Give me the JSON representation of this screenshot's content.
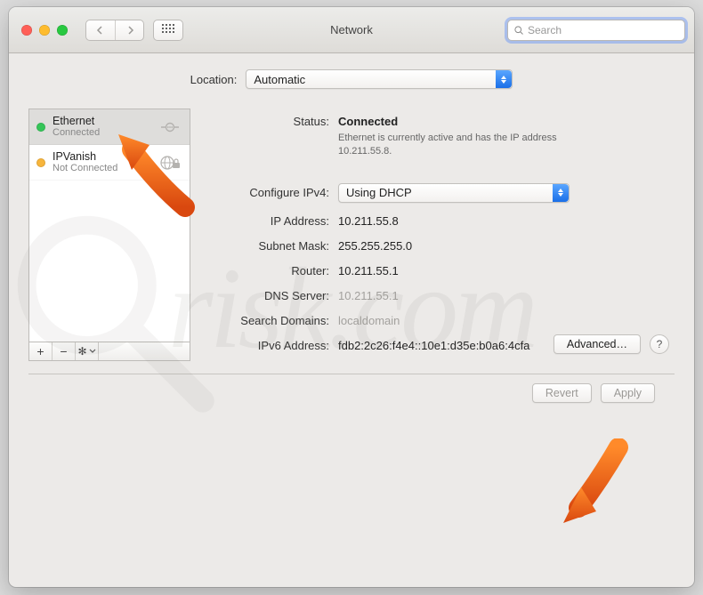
{
  "window": {
    "title": "Network"
  },
  "search": {
    "placeholder": "Search"
  },
  "location": {
    "label": "Location:",
    "value": "Automatic"
  },
  "sidebar": {
    "services": [
      {
        "name": "Ethernet",
        "status": "Connected",
        "dot": "green",
        "icon": "ethernet"
      },
      {
        "name": "IPVanish",
        "status": "Not Connected",
        "dot": "yellow",
        "icon": "vpn-globe"
      }
    ]
  },
  "detail": {
    "status_label": "Status:",
    "status_value": "Connected",
    "status_desc": "Ethernet is currently active and has the IP address 10.211.55.8.",
    "configure_label": "Configure IPv4:",
    "configure_value": "Using DHCP",
    "rows": [
      {
        "label": "IP Address:",
        "value": "10.211.55.8",
        "muted": false
      },
      {
        "label": "Subnet Mask:",
        "value": "255.255.255.0",
        "muted": false
      },
      {
        "label": "Router:",
        "value": "10.211.55.1",
        "muted": false
      },
      {
        "label": "DNS Server:",
        "value": "10.211.55.1",
        "muted": true
      },
      {
        "label": "Search Domains:",
        "value": "localdomain",
        "muted": true
      },
      {
        "label": "IPv6 Address:",
        "value": "fdb2:2c26:f4e4::10e1:d35e:b0a6:4cfa",
        "muted": false
      }
    ],
    "advanced_label": "Advanced…",
    "help_label": "?"
  },
  "footer": {
    "revert": "Revert",
    "apply": "Apply"
  },
  "watermark": "risk.com"
}
